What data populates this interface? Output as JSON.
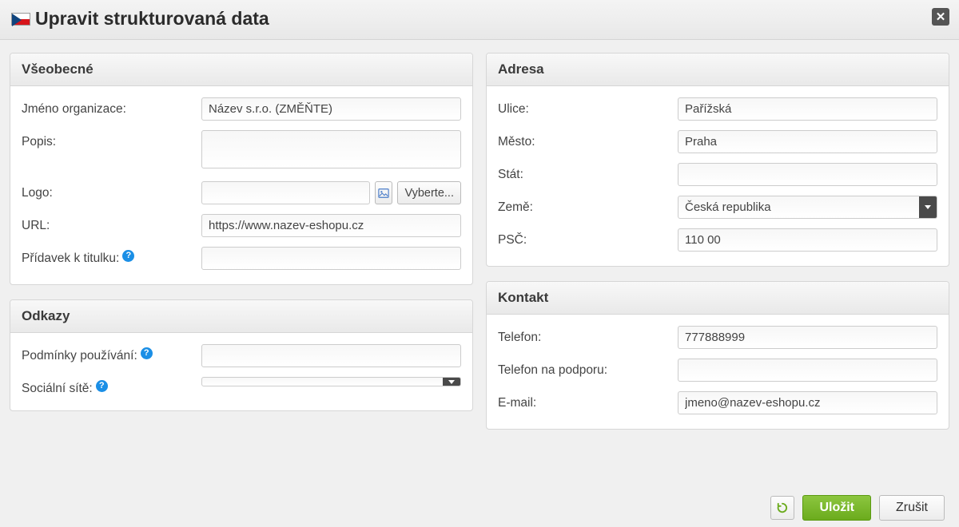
{
  "dialog": {
    "title": "Upravit strukturovaná data",
    "close_glyph": "✕"
  },
  "panels": {
    "general": {
      "title": "Všeobecné",
      "org_name_label": "Jméno organizace:",
      "org_name_value": "Název s.r.o. (ZMĚŇTE)",
      "desc_label": "Popis:",
      "desc_value": "",
      "logo_label": "Logo:",
      "logo_value": "",
      "logo_pick_label": "Vyberte...",
      "url_label": "URL:",
      "url_value": "https://www.nazev-eshopu.cz",
      "title_suffix_label": "Přídavek k titulku:",
      "title_suffix_value": ""
    },
    "links": {
      "title": "Odkazy",
      "terms_label": "Podmínky používání:",
      "terms_value": "",
      "social_label": "Sociální sítě:",
      "social_value": ""
    },
    "address": {
      "title": "Adresa",
      "street_label": "Ulice:",
      "street_value": "Pařížská",
      "city_label": "Město:",
      "city_value": "Praha",
      "state_label": "Stát:",
      "state_value": "",
      "country_label": "Země:",
      "country_value": "Česká republika",
      "zip_label": "PSČ:",
      "zip_value": "110 00"
    },
    "contact": {
      "title": "Kontakt",
      "phone_label": "Telefon:",
      "phone_value": "777888999",
      "support_phone_label": "Telefon na podporu:",
      "support_phone_value": "",
      "email_label": "E-mail:",
      "email_value": "jmeno@nazev-eshopu.cz"
    }
  },
  "footer": {
    "save_label": "Uložit",
    "cancel_label": "Zrušit"
  }
}
